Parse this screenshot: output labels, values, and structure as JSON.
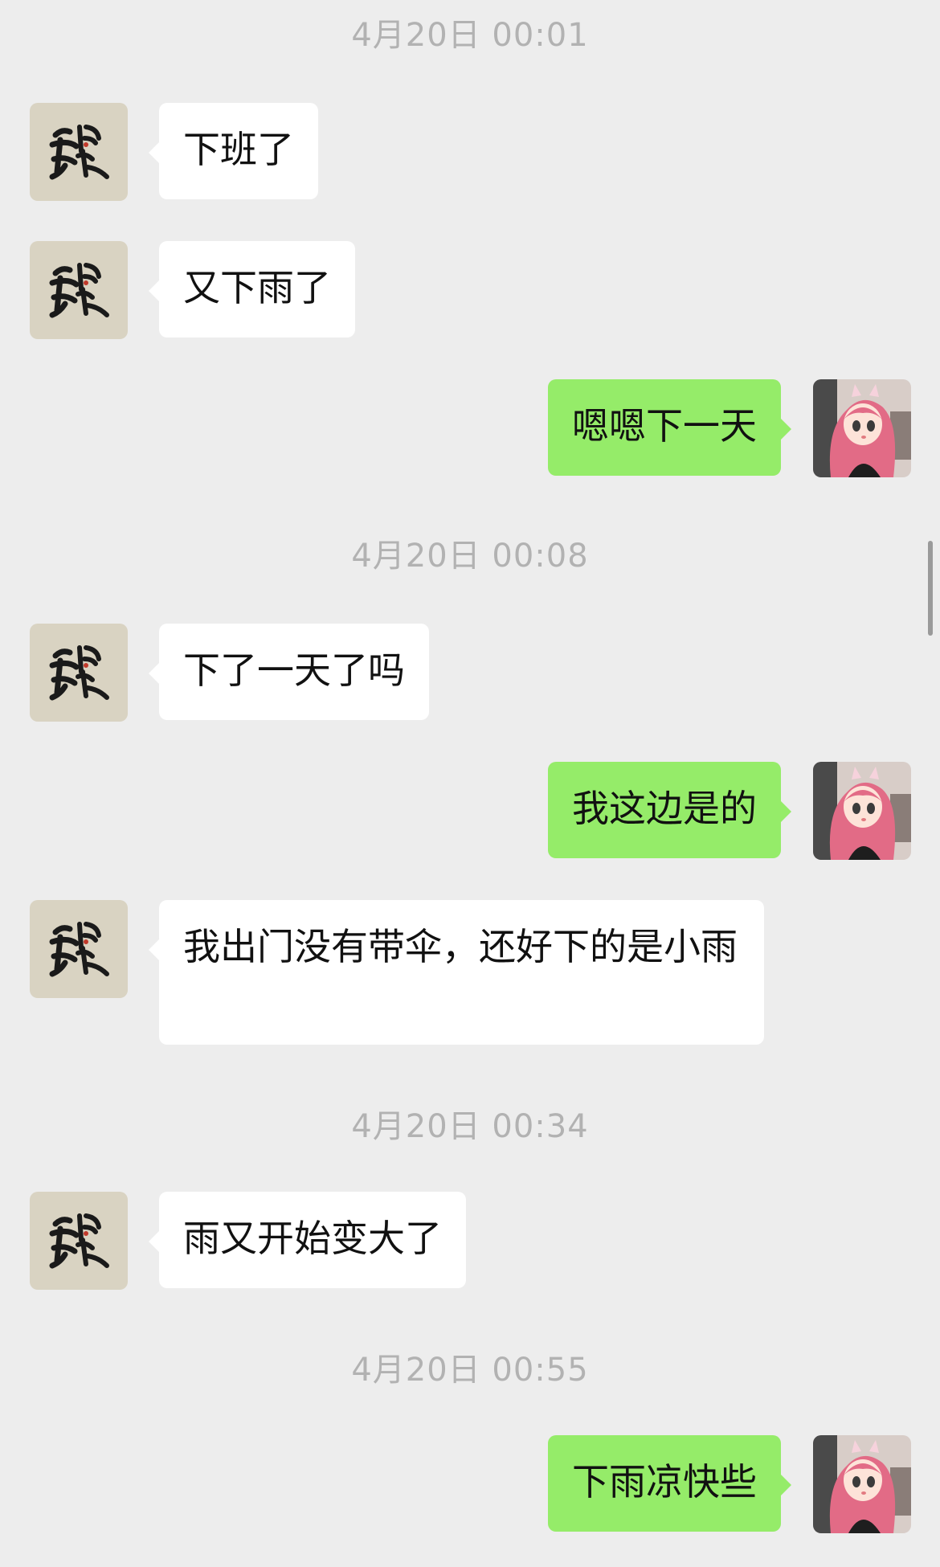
{
  "colors": {
    "background": "#ededed",
    "incoming_bubble": "#ffffff",
    "outgoing_bubble": "#95ec69",
    "timestamp_text": "#b2b2b2"
  },
  "contacts": {
    "friend_avatar": "calligraphy-avatar",
    "self_avatar": "cartoon-girl-avatar"
  },
  "timestamps": [
    "4月20日 00:01",
    "4月20日 00:08",
    "4月20日 00:34",
    "4月20日 00:55"
  ],
  "messages": [
    {
      "sender": "friend",
      "text": "下班了"
    },
    {
      "sender": "friend",
      "text": "又下雨了"
    },
    {
      "sender": "self",
      "text": "嗯嗯下一天"
    },
    {
      "sender": "friend",
      "text": "下了一天了吗"
    },
    {
      "sender": "self",
      "text": "我这边是的"
    },
    {
      "sender": "friend",
      "text": "我出门没有带伞，还好下的是小雨"
    },
    {
      "sender": "friend",
      "text": "雨又开始变大了"
    },
    {
      "sender": "self",
      "text": "下雨凉快些"
    }
  ]
}
